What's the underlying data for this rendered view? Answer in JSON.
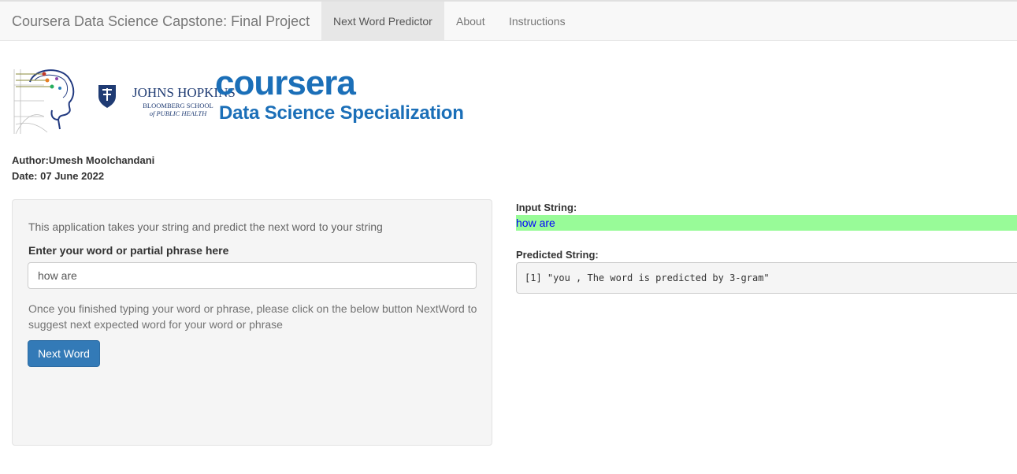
{
  "navbar": {
    "brand": "Coursera Data Science Capstone: Final Project",
    "tabs": [
      {
        "label": "Next Word Predictor",
        "active": true
      },
      {
        "label": "About",
        "active": false
      },
      {
        "label": "Instructions",
        "active": false
      }
    ]
  },
  "logos": {
    "jhu_name": "JOHNS HOPKINS",
    "jhu_sub1": "BLOOMBERG SCHOOL",
    "jhu_sub2": "of PUBLIC HEALTH",
    "coursera": "coursera",
    "specialization": "Data Science Specialization"
  },
  "meta": {
    "author": "Author:Umesh Moolchandani",
    "date": "Date: 07 June 2022"
  },
  "sidebar": {
    "description": "This application takes your string and predict the next word to your string",
    "input_label": "Enter your word or partial phrase here",
    "input_value": "how are",
    "help_text": "Once you finished typing your word or phrase, please click on the below button NextWord to suggest next expected word for your word or phrase",
    "button_label": "Next Word"
  },
  "output": {
    "input_label": "Input String:",
    "input_value": "how are",
    "predicted_label": "Predicted String:",
    "predicted_value": "[1] \"you , The word is predicted by 3-gram\""
  },
  "colors": {
    "primary": "#337ab7",
    "highlight": "#98fb98",
    "brand_blue": "#1b6fb8"
  }
}
